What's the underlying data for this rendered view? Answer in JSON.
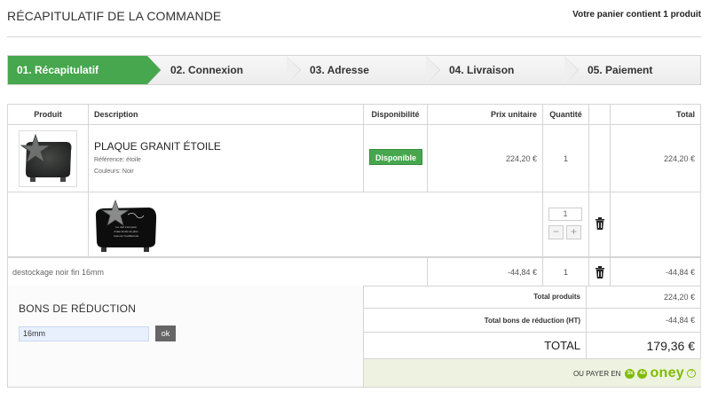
{
  "header": {
    "title": "RÉCAPITULATIF DE LA COMMANDE",
    "cart_summary": "Votre panier contient 1 produit"
  },
  "steps": [
    {
      "label": "01. Récapitulatif",
      "active": true
    },
    {
      "label": "02. Connexion",
      "active": false
    },
    {
      "label": "03. Adresse",
      "active": false
    },
    {
      "label": "04. Livraison",
      "active": false
    },
    {
      "label": "05. Paiement",
      "active": false
    }
  ],
  "table": {
    "headers": {
      "product": "Produit",
      "description": "Description",
      "availability": "Disponibilité",
      "unit_price": "Prix unitaire",
      "quantity": "Quantité",
      "total": "Total"
    },
    "item": {
      "name": "PLAQUE GRANIT ÉTOILE",
      "reference": "Référence: étoile",
      "color": "Couleurs: Noir",
      "availability": "Disponible",
      "unit_price": "224,20 €",
      "quantity": "1",
      "total": "224,20 €"
    },
    "customization": {
      "quantity_value": "1",
      "minus": "−",
      "plus": "+"
    },
    "discount_line": {
      "label": "destockage noir fin 16mm",
      "unit_price": "-44,84 €",
      "quantity": "1",
      "total": "-44,84 €"
    }
  },
  "vouchers": {
    "title": "BONS DE RÉDUCTION",
    "code": "16mm",
    "ok_label": "ok"
  },
  "totals": {
    "products_label": "Total produits",
    "products_value": "224,20 €",
    "vouchers_label": "Total bons de réduction (HT)",
    "vouchers_value": "-44,84 €",
    "total_label": "TOTAL",
    "total_value": "179,36 €"
  },
  "payment": {
    "oney_text": "OU PAYER EN",
    "oney_brand": "oney",
    "badge_3x": "3x",
    "badge_4x": "4x"
  },
  "colors": {
    "green": "#46a74e",
    "oney_green": "#81bc00",
    "border": "#d6d4d4"
  }
}
